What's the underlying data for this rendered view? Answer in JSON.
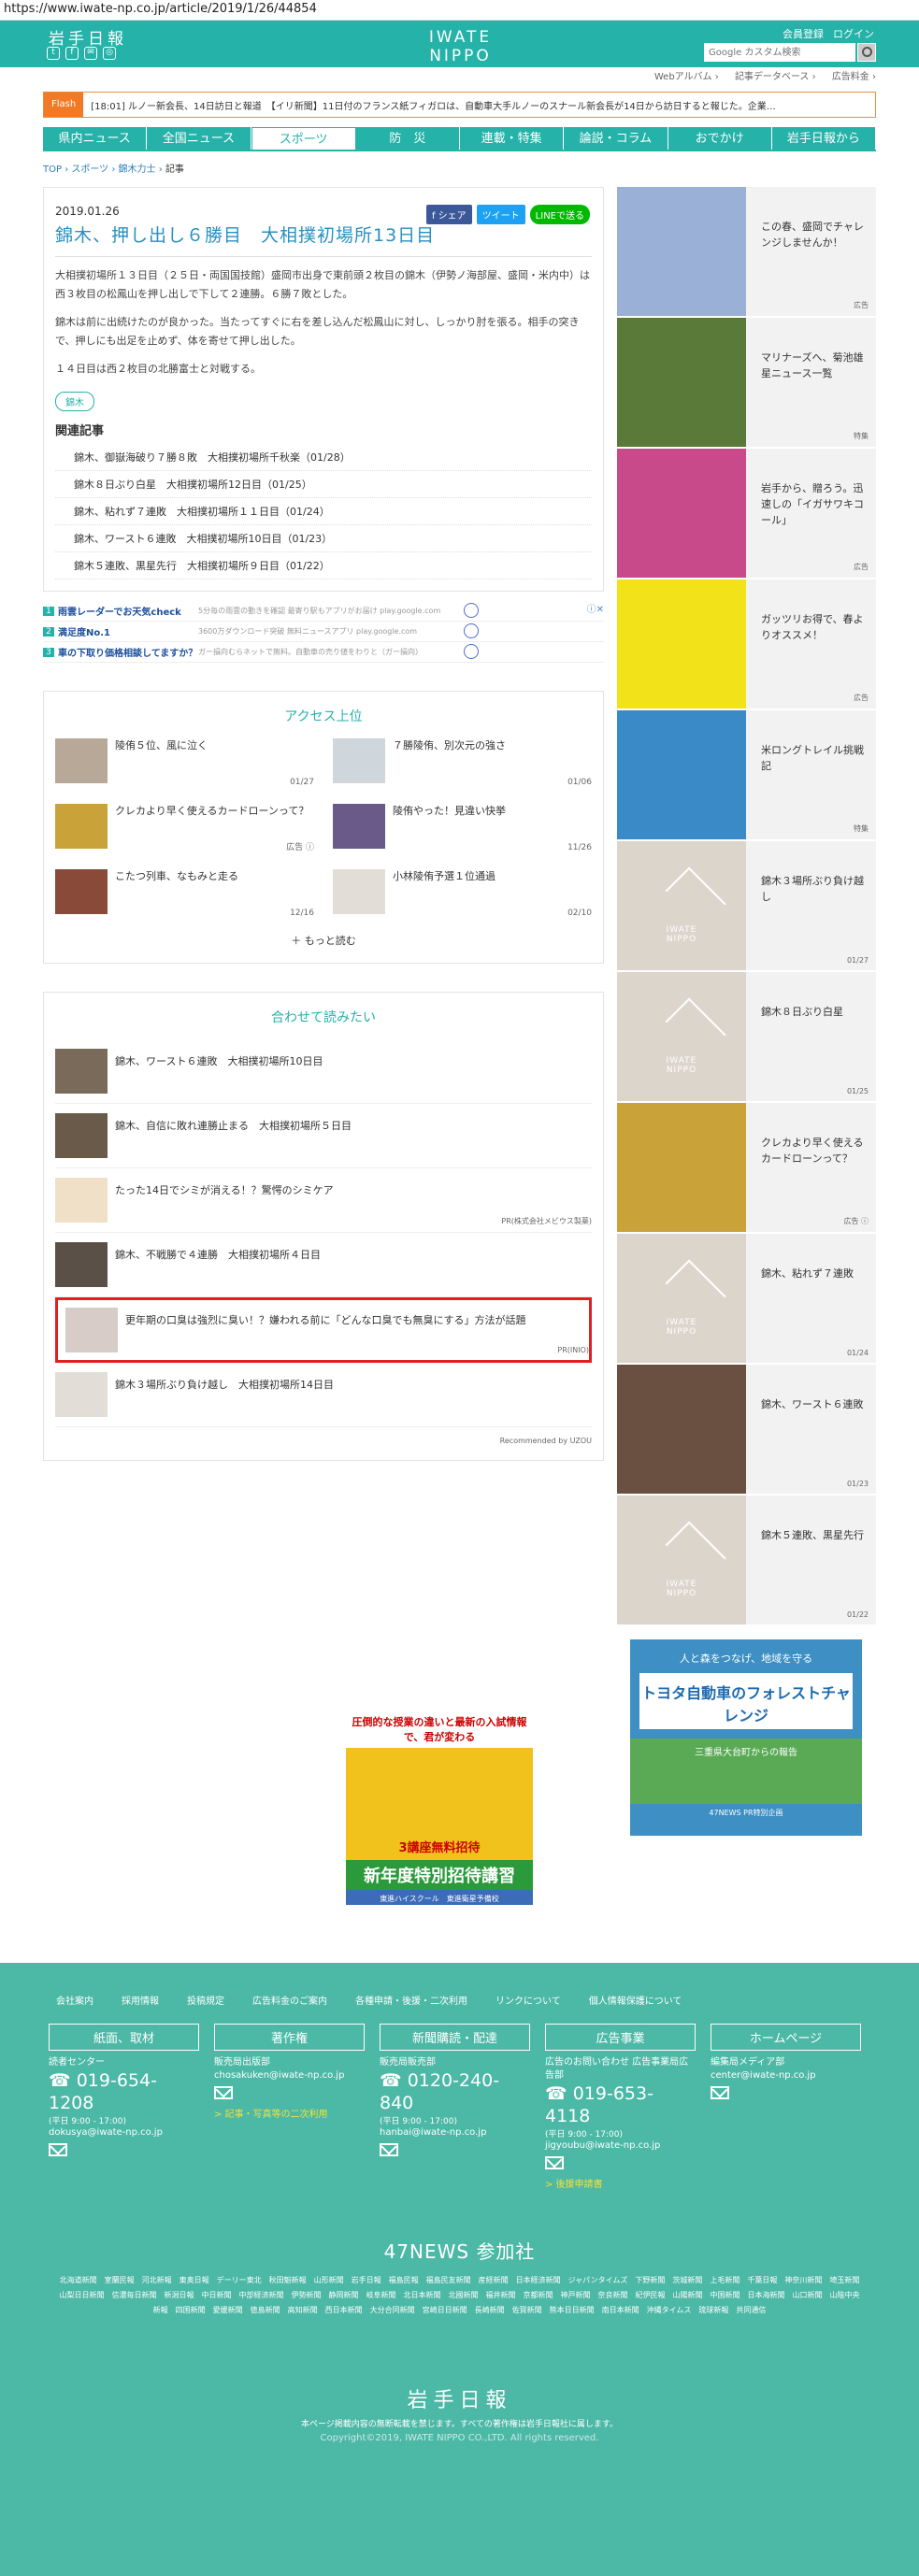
{
  "url": "https://www.iwate-np.co.jp/article/2019/1/26/44854",
  "header": {
    "logo": "岩手日報",
    "brand": "IWATE NIPPO",
    "date": "2019.02.11. 月",
    "member": "会員登録",
    "login": "ログイン",
    "search_placeholder": "Google カスタム検索"
  },
  "sublinks": [
    "Webアルバム ›",
    "記事データベース ›",
    "広告料金 ›"
  ],
  "flash": {
    "label": "Flash",
    "text": "[18:01] ルノー新会長、14日訪日と報道　【イリ新聞】11日付のフランス紙フィガロは、自動車大手ルノーのスナール新会長が14日から訪日すると報じた。企業…"
  },
  "nav": [
    "県内ニュース",
    "全国ニュース",
    "スポーツ",
    "防　災",
    "連載・特集",
    "論説・コラム",
    "おでかけ",
    "岩手日報から"
  ],
  "breadcrumb": [
    "TOP",
    "スポーツ",
    "錦木力士",
    "記事"
  ],
  "article": {
    "date": "2019.01.26",
    "title": "錦木、押し出し６勝目　大相撲初場所13日目",
    "share_fb": "f シェア",
    "share_tw": "ツイート",
    "share_line": "LINEで送る",
    "paragraphs": [
      "大相撲初場所１３日目（２５日・両国国技館）盛岡市出身で東前頭２枚目の錦木（伊勢ノ海部屋、盛岡・米内中）は西３枚目の松鳳山を押し出しで下して２連勝。６勝７敗とした。",
      "錦木は前に出続けたのが良かった。当たってすぐに右を差し込んだ松鳳山に対し、しっかり肘を張る。相手の突きで、押しにも出足を止めず、体を寄せて押し出した。",
      "１４日目は西２枚目の北勝富士と対戦する。"
    ],
    "tag": "錦木",
    "related_title": "関連記事",
    "related": [
      "錦木、御嶽海破り７勝８敗　大相撲初場所千秋楽（01/28）",
      "錦木８日ぶり白星　大相撲初場所12日目（01/25）",
      "錦木、粘れず７連敗　大相撲初場所１１日目（01/24）",
      "錦木、ワースト６連敗　大相撲初場所10日目（01/23）",
      "錦木５連敗、黒星先行　大相撲初場所９日目（01/22）"
    ]
  },
  "ads": [
    {
      "num": "1",
      "title": "雨雲レーダーでお天気check",
      "sub": "5分毎の雨雲の動きを確認 最寄り駅もアプリがお届け play.google.com"
    },
    {
      "num": "2",
      "title": "満足度No.1",
      "sub": "3600万ダウンロード突破 無料ニュースアプリ play.google.com"
    },
    {
      "num": "3",
      "title": "車の下取り価格相談してますか？",
      "sub": "ガー損向むらネットで無料。自動車の売り値をわりと（ガー損向）"
    }
  ],
  "ranking": {
    "title": "アクセス上位",
    "items": [
      {
        "text": "陵侑５位、風に泣く",
        "date": "01/27"
      },
      {
        "text": "７勝陵侑、別次元の強さ",
        "date": "01/06"
      },
      {
        "text": "クレカより早く使えるカードローンって？",
        "date": "広告 ⓘ"
      },
      {
        "text": "陵侑やった！見違い快挙",
        "date": "11/26"
      },
      {
        "text": "こたつ列車、なもみと走る",
        "date": "12/16"
      },
      {
        "text": "小林陵侑予選１位通過",
        "date": "02/10"
      }
    ],
    "more": "もっと読む"
  },
  "recommend": {
    "title": "合わせて読みたい",
    "items": [
      {
        "text": "錦木、ワースト６連敗　大相撲初場所10日目",
        "pr": ""
      },
      {
        "text": "錦木、自信に敗れ連勝止まる　大相撲初場所５日目",
        "pr": ""
      },
      {
        "text": "たった14日でシミが消える！？驚愕のシミケア",
        "pr": "PR(株式会社メビウス製薬)"
      },
      {
        "text": "錦木、不戦勝で４連勝　大相撲初場所４日目",
        "pr": ""
      },
      {
        "text": "更年期の口臭は強烈に臭い！？嫌われる前に「どんな口臭でも無臭にする」方法が話題",
        "pr": "PR(INIO)"
      },
      {
        "text": "錦木３場所ぶり負け越し　大相撲初場所14日目",
        "pr": ""
      }
    ],
    "by": "Recommended by UZOU"
  },
  "banner": {
    "top": "圧倒的な授業の違いと最新の入試情報で、君が変わる",
    "mid": "3講座無料招待",
    "big": "新年度特別招待講習",
    "btm": "東進ハイスクール　東進衛星予備校"
  },
  "side": [
    {
      "text": "この春、盛岡でチャレンジしませんか！",
      "tag": "広告"
    },
    {
      "text": "マリナーズへ、菊池雄星ニュース一覧",
      "tag": "特集"
    },
    {
      "text": "岩手から、贈ろう。迅速しの「イガサワキコール」",
      "tag": "広告"
    },
    {
      "text": "ガッツリお得で、春よりオススメ！",
      "tag": "広告"
    },
    {
      "text": "米ロングトレイル挑戦記",
      "tag": "特集"
    },
    {
      "text": "錦木３場所ぶり負け越し",
      "tag": "01/27"
    },
    {
      "text": "錦木８日ぶり白星",
      "tag": "01/25"
    },
    {
      "text": "クレカより早く使えるカードローンって？",
      "tag": "広告 ⓘ"
    },
    {
      "text": "錦木、粘れず７連敗",
      "tag": "01/24"
    },
    {
      "text": "錦木、ワースト６連敗",
      "tag": "01/23"
    },
    {
      "text": "錦木５連敗、黒星先行",
      "tag": "01/22"
    }
  ],
  "side_banner": {
    "top": "人と森をつなげ、地域を守る",
    "main": "トヨタ自動車のフォレストチャレンジ",
    "sub": "三重県大台町からの報告",
    "foot": "47NEWS PR特別企画"
  },
  "footer": {
    "links": [
      "会社案内",
      "採用情報",
      "投稿規定",
      "広告料金のご案内",
      "各種申請・後援・二次利用",
      "リンクについて",
      "個人情報保護について"
    ],
    "cols": [
      {
        "head": "紙面、取材",
        "l1": "読者センター",
        "tel": "019-654-1208",
        "hours": "(平日 9:00 - 17:00)",
        "mail": "dokusya@iwate-np.co.jp",
        "extra": ""
      },
      {
        "head": "著作権",
        "l1": "販売局出版部",
        "tel": "",
        "hours": "",
        "mail": "chosakuken@iwate-np.co.jp",
        "extra": "> 記事・写真等の二次利用"
      },
      {
        "head": "新聞購読・配達",
        "l1": "販売局販売部",
        "tel": "0120-240-840",
        "hours": "(平日 9:00 - 17:00)",
        "mail": "hanbai@iwate-np.co.jp",
        "extra": ""
      },
      {
        "head": "広告事業",
        "l1": "広告のお問い合わせ 広告事業局広告部",
        "tel": "019-653-4118",
        "hours": "(平日 9:00 - 17:00)",
        "mail": "jigyoubu@iwate-np.co.jp",
        "extra": "> 後援申請書"
      },
      {
        "head": "ホームページ",
        "l1": "編集局メディア部",
        "tel": "",
        "hours": "",
        "mail": "center@iwate-np.co.jp",
        "extra": ""
      }
    ],
    "n47": "47NEWS 参加社",
    "papers": "北海道新聞　室蘭民報　河北新報　東奥日報　デーリー東北　秋田魁新報　山形新聞　岩手日報　福島民報　福島民友新聞　産経新聞　日本経済新聞　ジャパンタイムズ　下野新聞　茨城新聞　上毛新聞　千葉日報　神奈川新聞　埼玉新聞　山梨日日新聞　信濃毎日新聞　新潟日報　中日新聞　中部経済新聞　伊勢新聞　静岡新聞　岐阜新聞　北日本新聞　北國新聞　福井新聞　京都新聞　神戸新聞　奈良新聞　紀伊民報　山陽新聞　中国新聞　日本海新聞　山口新聞　山陰中央新報　四国新聞　愛媛新聞　徳島新聞　高知新聞　西日本新聞　大分合同新聞　宮崎日日新聞　長崎新聞　佐賀新聞　熊本日日新聞　南日本新聞　沖縄タイムス　琉球新報　共同通信",
    "logo": "岩手日報",
    "note": "本ページ掲載内容の無断転載を禁じます。すべての著作権は岩手日報社に属します。",
    "copy": "Copyright©2019, IWATE NIPPO CO.,LTD. All rights reserved."
  }
}
